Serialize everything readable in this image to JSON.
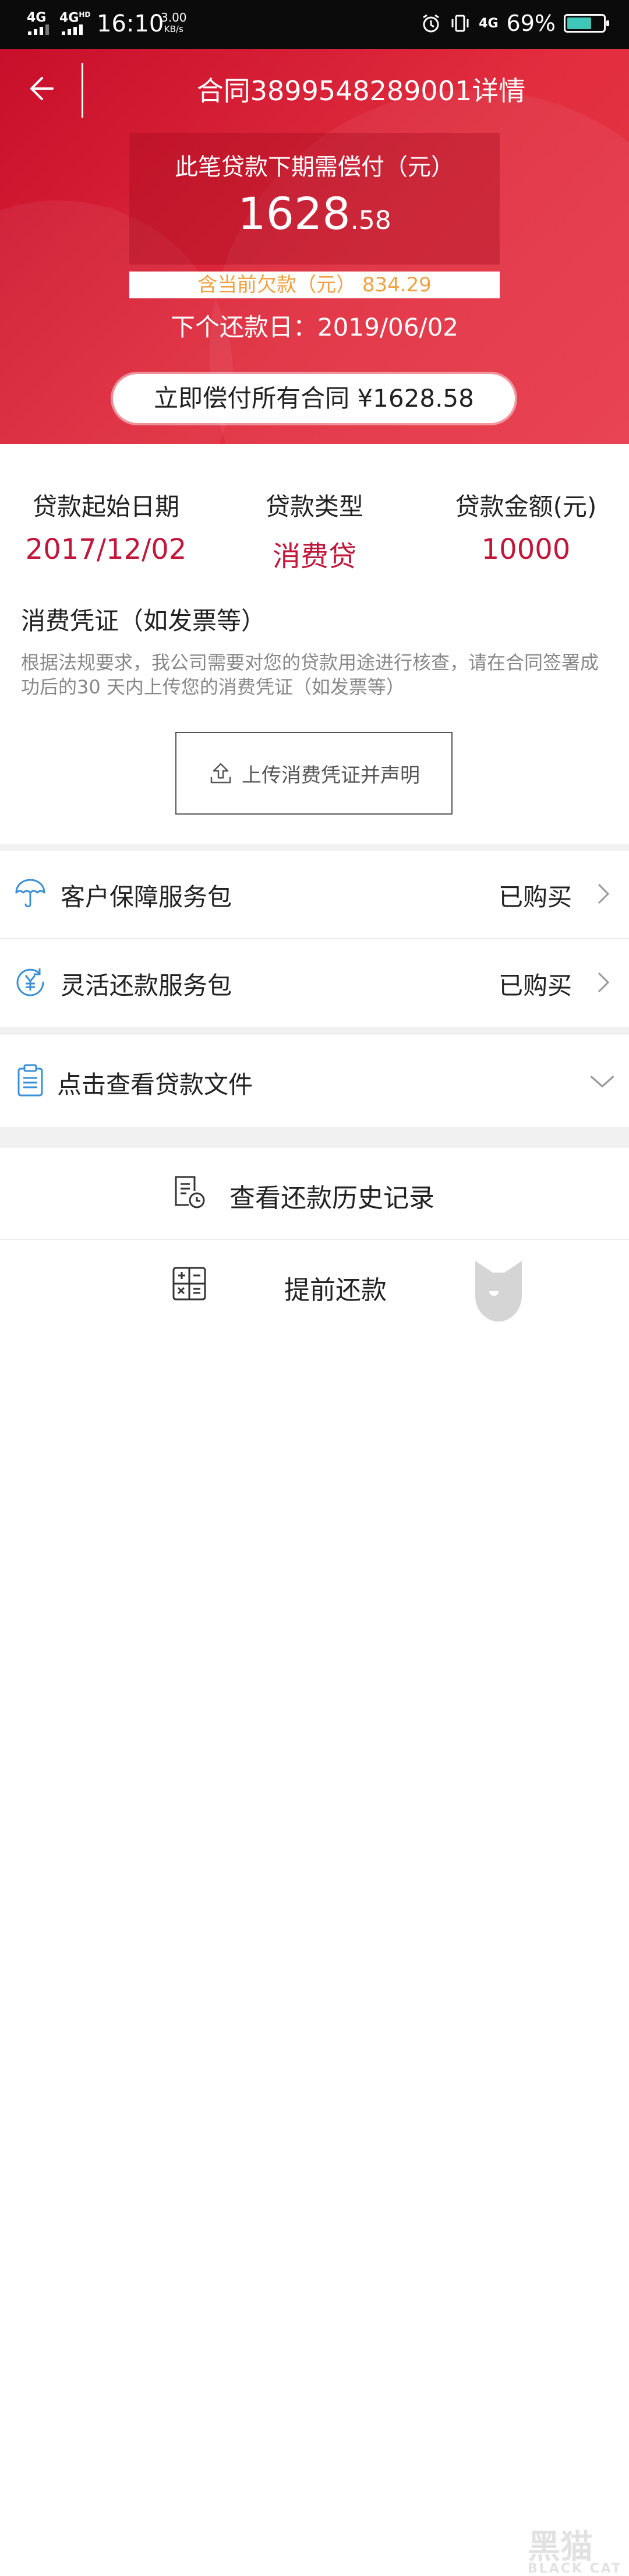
{
  "status_bar": {
    "signal_1": "4G",
    "signal_2": "4G",
    "signal_2_sup": "HD",
    "time": "16:10",
    "speed_value": "3.00",
    "speed_unit": "KB/s",
    "network_right": "4G",
    "battery": "69%",
    "battery_level": 0.69,
    "battery_color": "#3ec7b9",
    "icons": [
      "alarm-icon",
      "vibrate-icon",
      "battery-icon"
    ]
  },
  "header": {
    "title": "合同3899548289001详情",
    "due_label": "此笔贷款下期需偿付（元）",
    "due_amount_int": "1628",
    "due_amount_dec": ".58",
    "arrears": "含当前欠款（元） 834.29",
    "next_payment": "下个还款日：2019/06/02",
    "pay_all_button": "立即偿付所有合同 ¥1628.58",
    "accent_color": "#d4192f"
  },
  "loan_info": {
    "start_date_label": "贷款起始日期",
    "start_date": "2017/12/02",
    "type_label": "贷款类型",
    "type": "消费贷",
    "amount_label": "贷款金额(元)",
    "amount": "10000",
    "value_color": "#c0173a"
  },
  "voucher": {
    "title": "消费凭证（如发票等）",
    "description": "根据法规要求，我公司需要对您的贷款用途进行核查，请在合同签署成功后的30 天内上传您的消费凭证（如发票等）",
    "upload_button": "上传消费凭证并声明"
  },
  "service_rows": [
    {
      "label": "客户保障服务包",
      "value": "已购买",
      "icon": "umbrella-icon"
    },
    {
      "label": "灵活还款服务包",
      "value": "已购买",
      "icon": "yuan-refresh-icon"
    }
  ],
  "documents_row": {
    "label": "点击查看贷款文件",
    "icon": "clipboard-icon"
  },
  "actions": {
    "history": "查看还款历史记录",
    "prepay": "提前还款"
  },
  "watermark": {
    "text": "黑猫",
    "sub": "BLACK CAT"
  }
}
